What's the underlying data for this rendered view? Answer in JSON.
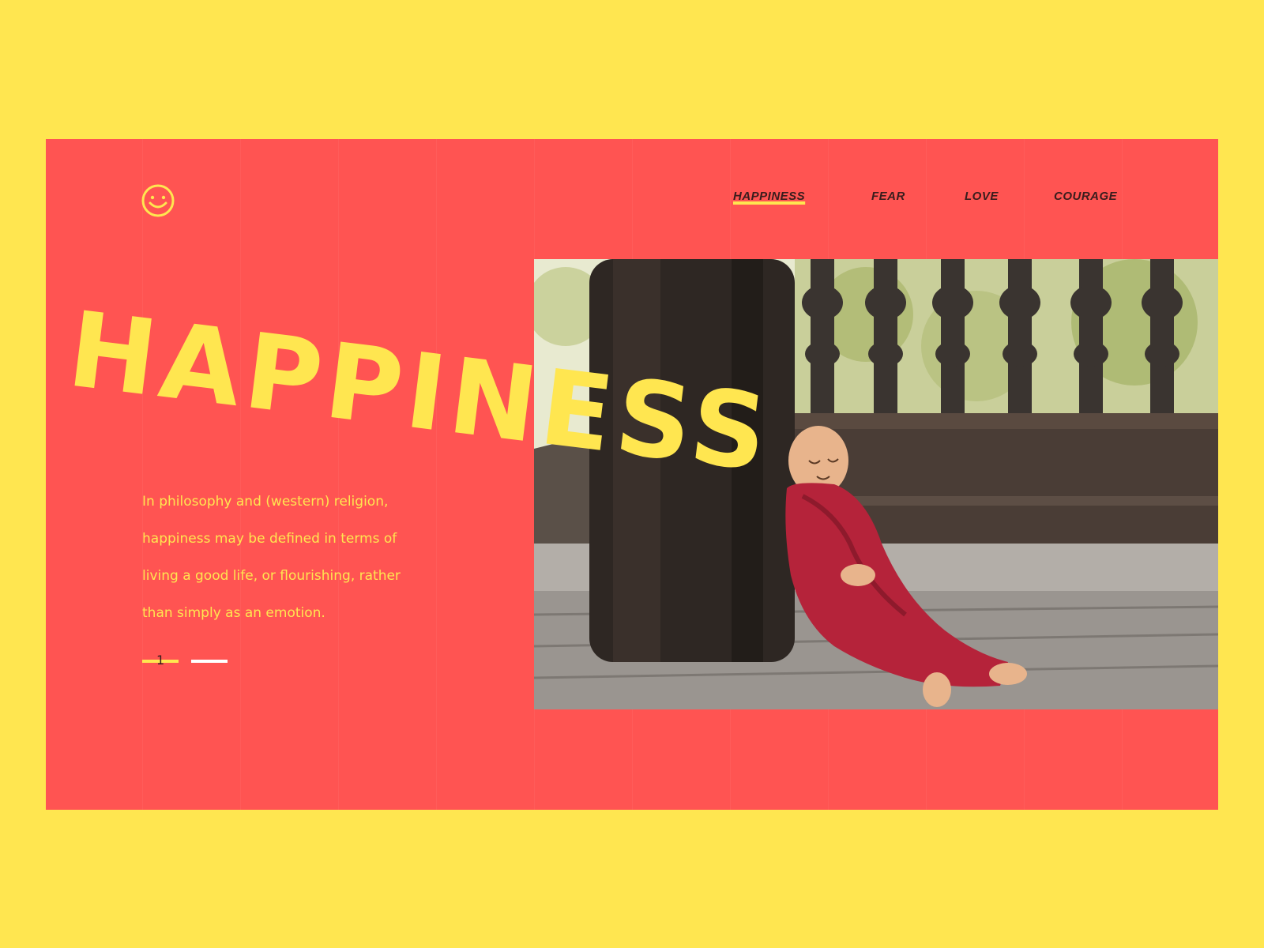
{
  "colors": {
    "background": "#FFE650",
    "card": "#FF5452",
    "accent": "#FFE650",
    "nav_text": "#3a1d1d"
  },
  "logo": {
    "icon": "smiley-face-icon"
  },
  "nav": {
    "items": [
      {
        "label": "HAPPINESS",
        "active": true
      },
      {
        "label": "FEAR",
        "active": false
      },
      {
        "label": "LOVE",
        "active": false
      },
      {
        "label": "COURAGE",
        "active": false
      }
    ]
  },
  "hero": {
    "headline": "HAPPINESS",
    "description_lines": [
      "In philosophy and (western) religion,",
      "happiness may be defined in terms of",
      "living a good life, or flourishing, rather",
      "than simply as an emotion."
    ],
    "photo": "photo of a young monk in red robe smiling beside a wooden pillar"
  },
  "pager": {
    "current": "1",
    "total_slides": 2
  }
}
